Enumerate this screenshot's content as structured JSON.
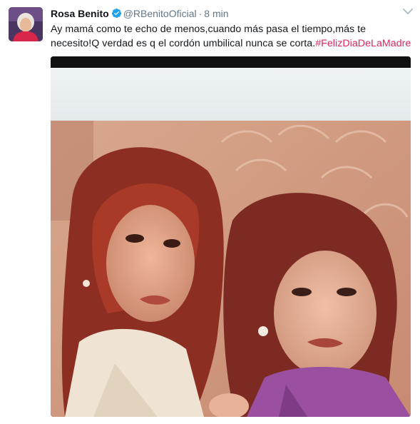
{
  "tweet": {
    "author_name": "Rosa Benito",
    "handle": "@RBenitoOficial",
    "separator": "·",
    "time": "8 min",
    "text_line1": "Ay mamá como te echo de menos,cuando más pasa el tiempo,más te",
    "text_line2": "necesito!Q verdad es q el cordón umbilical nunca se corta.",
    "hashtag": "#FelizDiaDeLaMadre"
  },
  "colors": {
    "verified_blue": "#1da1f2",
    "hashtag": "#e0245e",
    "secondary_text": "#657786"
  },
  "icons": {
    "verified": "verified-badge-icon",
    "more": "chevron-down-icon"
  }
}
